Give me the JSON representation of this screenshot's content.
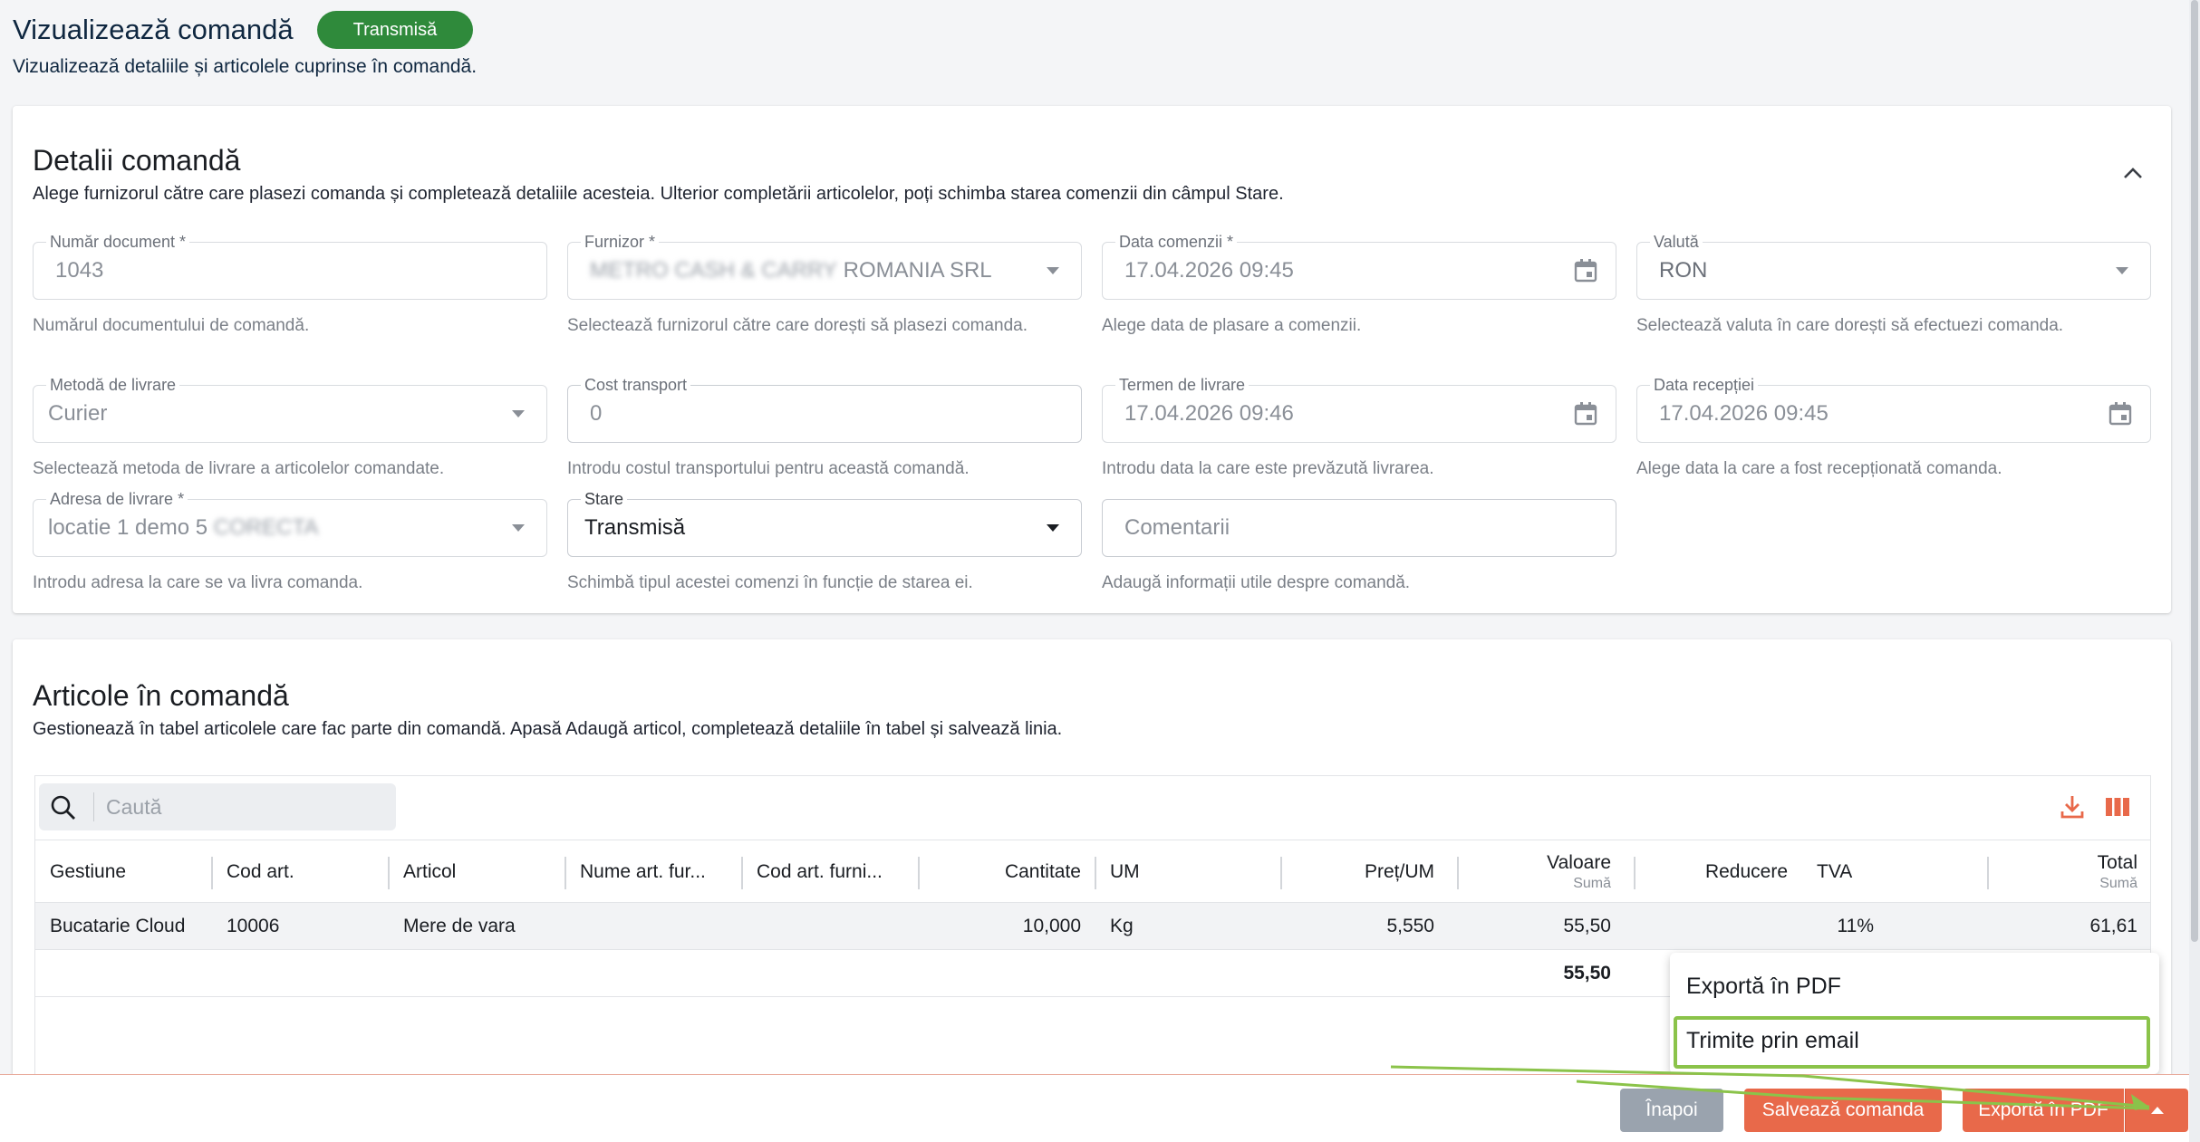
{
  "page": {
    "title": "Vizualizează comandă",
    "status": "Transmisă",
    "subtitle": "Vizualizează detaliile și articolele cuprinse în comandă."
  },
  "details": {
    "title": "Detalii comandă",
    "description": "Alege furnizorul către care plasezi comanda și completează detaliile acesteia. Ulterior completării articolelor, poți schimba starea comenzii din câmpul Stare.",
    "fields": {
      "doc_number": {
        "label": "Număr document *",
        "value": "1043",
        "help": "Numărul documentului de comandă."
      },
      "supplier": {
        "label": "Furnizor *",
        "value_hidden": "METRO CASH & CARRY",
        "value": "ROMANIA SRL",
        "help": "Selectează furnizorul către care dorești să plasezi comanda."
      },
      "order_date": {
        "label": "Data comenzii *",
        "value": "17.04.2026 09:45",
        "help": "Alege data de plasare a comenzii."
      },
      "currency": {
        "label": "Valută",
        "value": "RON",
        "help": "Selectează valuta în care dorești să efectuezi comanda."
      },
      "delivery_method": {
        "label": "Metodă de livrare",
        "value": "Curier",
        "help": "Selectează metoda de livrare a articolelor comandate."
      },
      "transport_cost": {
        "label": "Cost transport",
        "value": "0",
        "help": "Introdu costul transportului pentru această comandă."
      },
      "delivery_term": {
        "label": "Termen de livrare",
        "value": "17.04.2026 09:46",
        "help": "Introdu data la care este prevăzută livrarea."
      },
      "reception_date": {
        "label": "Data recepției",
        "value": "17.04.2026 09:45",
        "help": "Alege data la care a fost recepționată comanda."
      },
      "delivery_address": {
        "label": "Adresa de livrare *",
        "value": "locatie 1 demo 5",
        "value_hidden": "CORECTA",
        "help": "Introdu adresa la care se va livra comanda."
      },
      "status": {
        "label": "Stare",
        "value": "Transmisă",
        "help": "Schimbă tipul acestei comenzi în funcție de starea ei."
      },
      "comments": {
        "placeholder": "Comentarii",
        "help": "Adaugă informații utile despre comandă."
      }
    }
  },
  "articles": {
    "title": "Articole în comandă",
    "description": "Gestionează în tabel articolele care fac parte din comandă. Apasă Adaugă articol, completează detaliile în tabel și salvează linia.",
    "search_placeholder": "Caută",
    "columns": {
      "gestiune": "Gestiune",
      "cod_art": "Cod art.",
      "articol": "Articol",
      "nume_furn": "Nume art. fur...",
      "cod_furn": "Cod art. furni...",
      "cantitate": "Cantitate",
      "um": "UM",
      "pret": "Preț/UM",
      "valoare": "Valoare",
      "valoare_sub": "Sumă",
      "reducere": "Reducere",
      "tva": "TVA",
      "total": "Total",
      "total_sub": "Sumă"
    },
    "rows": [
      {
        "gestiune": "Bucatarie Cloud",
        "cod_art": "10006",
        "articol": "Mere de vara",
        "nume_furn": "",
        "cod_furn": "",
        "cantitate": "10,000",
        "um": "Kg",
        "pret": "5,550",
        "valoare": "55,50",
        "reducere": "",
        "tva": "11%",
        "total": "61,61"
      }
    ],
    "totals": {
      "valoare": "55,50"
    }
  },
  "export_menu": {
    "items": [
      "Exportă în PDF",
      "Trimite prin email"
    ]
  },
  "footer": {
    "back": "Înapoi",
    "save": "Salvează comanda",
    "export": "Exportă în PDF"
  },
  "colors": {
    "status_green": "#2f8a3b",
    "accent_orange": "#e8694a",
    "back_gray": "#9aa3ae",
    "highlight_green": "#8bc34a"
  }
}
